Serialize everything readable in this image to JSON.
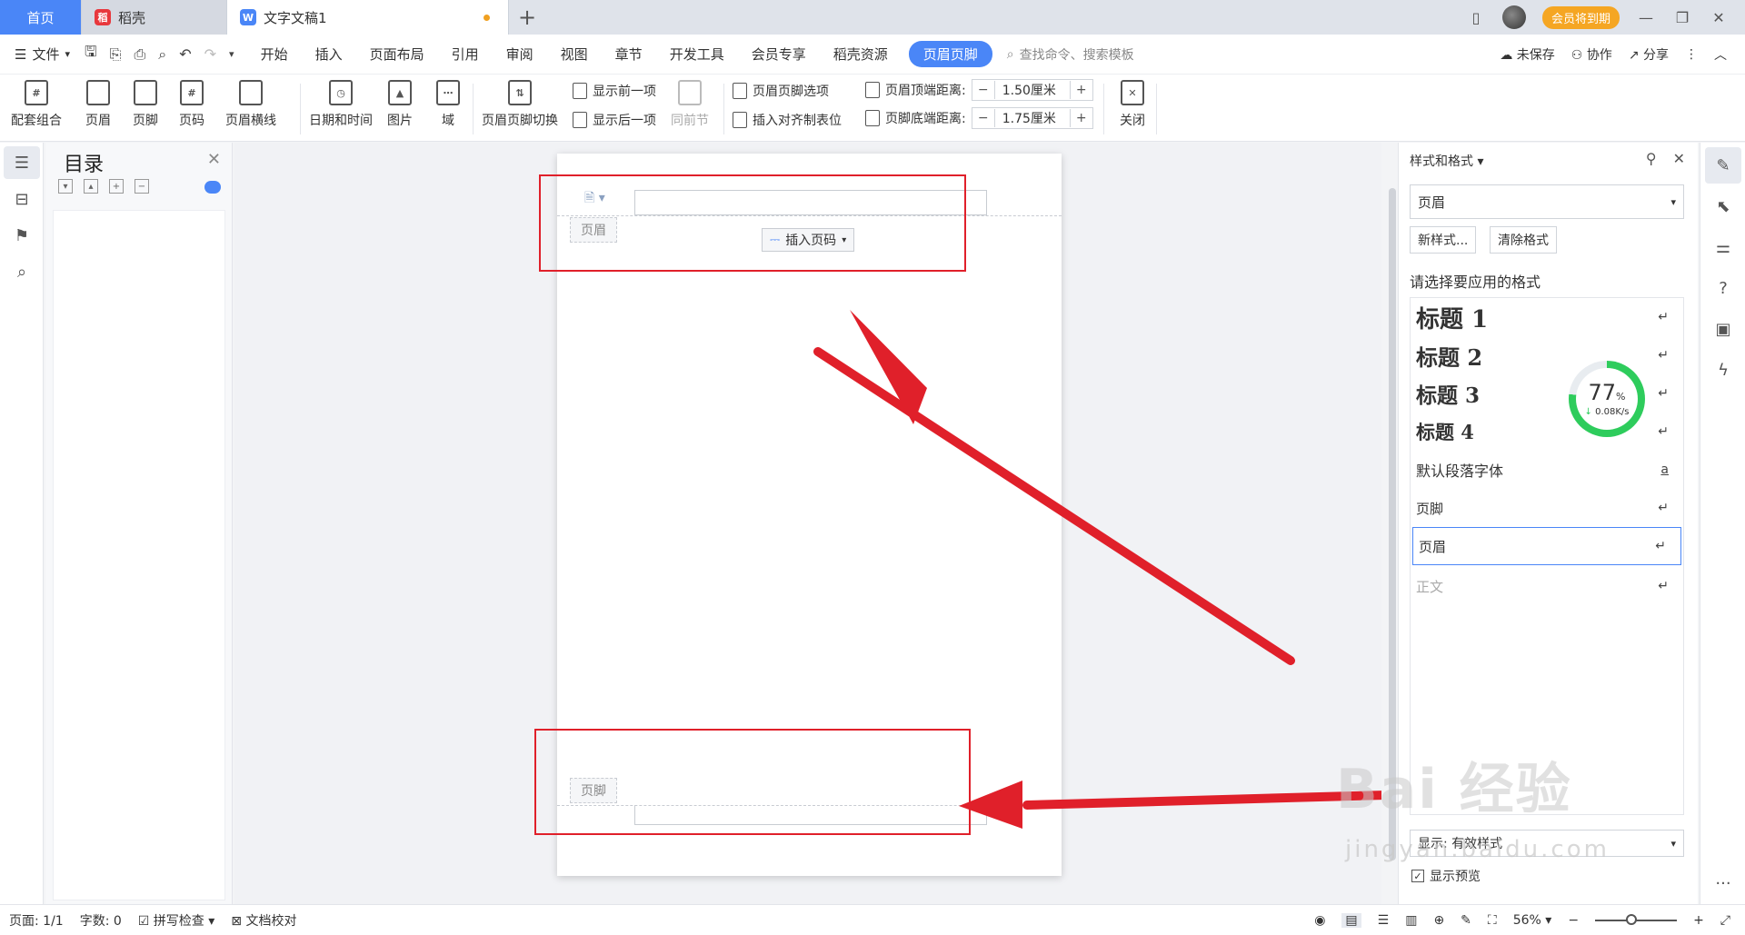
{
  "tabs": [
    {
      "label": "首页"
    },
    {
      "label": "稻壳"
    },
    {
      "label": "文字文稿1"
    }
  ],
  "topright": {
    "vip_label": "会员将到期"
  },
  "menubar": {
    "file_label": "文件",
    "items": [
      "开始",
      "插入",
      "页面布局",
      "引用",
      "审阅",
      "视图",
      "章节",
      "开发工具",
      "会员专享",
      "稻壳资源"
    ],
    "active": "页眉页脚",
    "search_placeholder": "查找命令、搜索模板",
    "unsaved": "未保存",
    "collab": "协作",
    "share": "分享"
  },
  "ribbon": {
    "set_combo": "配套组合",
    "header": "页眉",
    "footer": "页脚",
    "page_no": "页码",
    "header_line": "页眉横线",
    "datetime": "日期和时间",
    "picture": "图片",
    "field": "域",
    "switch": "页眉页脚切换",
    "show_prev": "显示前一项",
    "show_next": "显示后一项",
    "same_as_prev": "同前节",
    "hf_options": "页眉页脚选项",
    "insert_align_tab": "插入对齐制表位",
    "header_top_label": "页眉顶端距离:",
    "header_top_value": "1.50厘米",
    "footer_bottom_label": "页脚底端距离:",
    "footer_bottom_value": "1.75厘米",
    "close": "关闭"
  },
  "toc": {
    "title": "目录"
  },
  "page": {
    "header_tag": "页眉",
    "footer_tag": "页脚",
    "insert_page_number": "插入页码"
  },
  "styles_panel": {
    "title": "样式和格式",
    "current_style": "页眉",
    "new_style": "新样式...",
    "clear_format": "清除格式",
    "prompt": "请选择要应用的格式",
    "items": [
      {
        "label": "标题  1",
        "mark": "↵"
      },
      {
        "label": "标题  2",
        "mark": "↵"
      },
      {
        "label": "标题  3",
        "mark": "↵"
      },
      {
        "label": "标题  4",
        "mark": "↵"
      },
      {
        "label": "默认段落字体",
        "mark": "a"
      },
      {
        "label": "页脚",
        "mark": "↵"
      },
      {
        "label": "页眉",
        "mark": "↵"
      },
      {
        "label": "正文",
        "mark": "↵"
      }
    ],
    "show_label": "显示:",
    "show_value": "有效样式",
    "preview_label": "显示预览"
  },
  "gauge": {
    "percent": 77,
    "unit": "%",
    "speed": "0.08K/s"
  },
  "statusbar": {
    "page": "页面: 1/1",
    "words": "字数: 0",
    "spell": "拼写检查",
    "proof": "文档校对",
    "zoom": "56%"
  },
  "watermark": {
    "main": "Bai 经验",
    "sub": "jingyan.baidu.com"
  },
  "colors": {
    "accent": "#4a86f7",
    "annotation": "#e0202a",
    "gauge": "#2ecc5c"
  }
}
